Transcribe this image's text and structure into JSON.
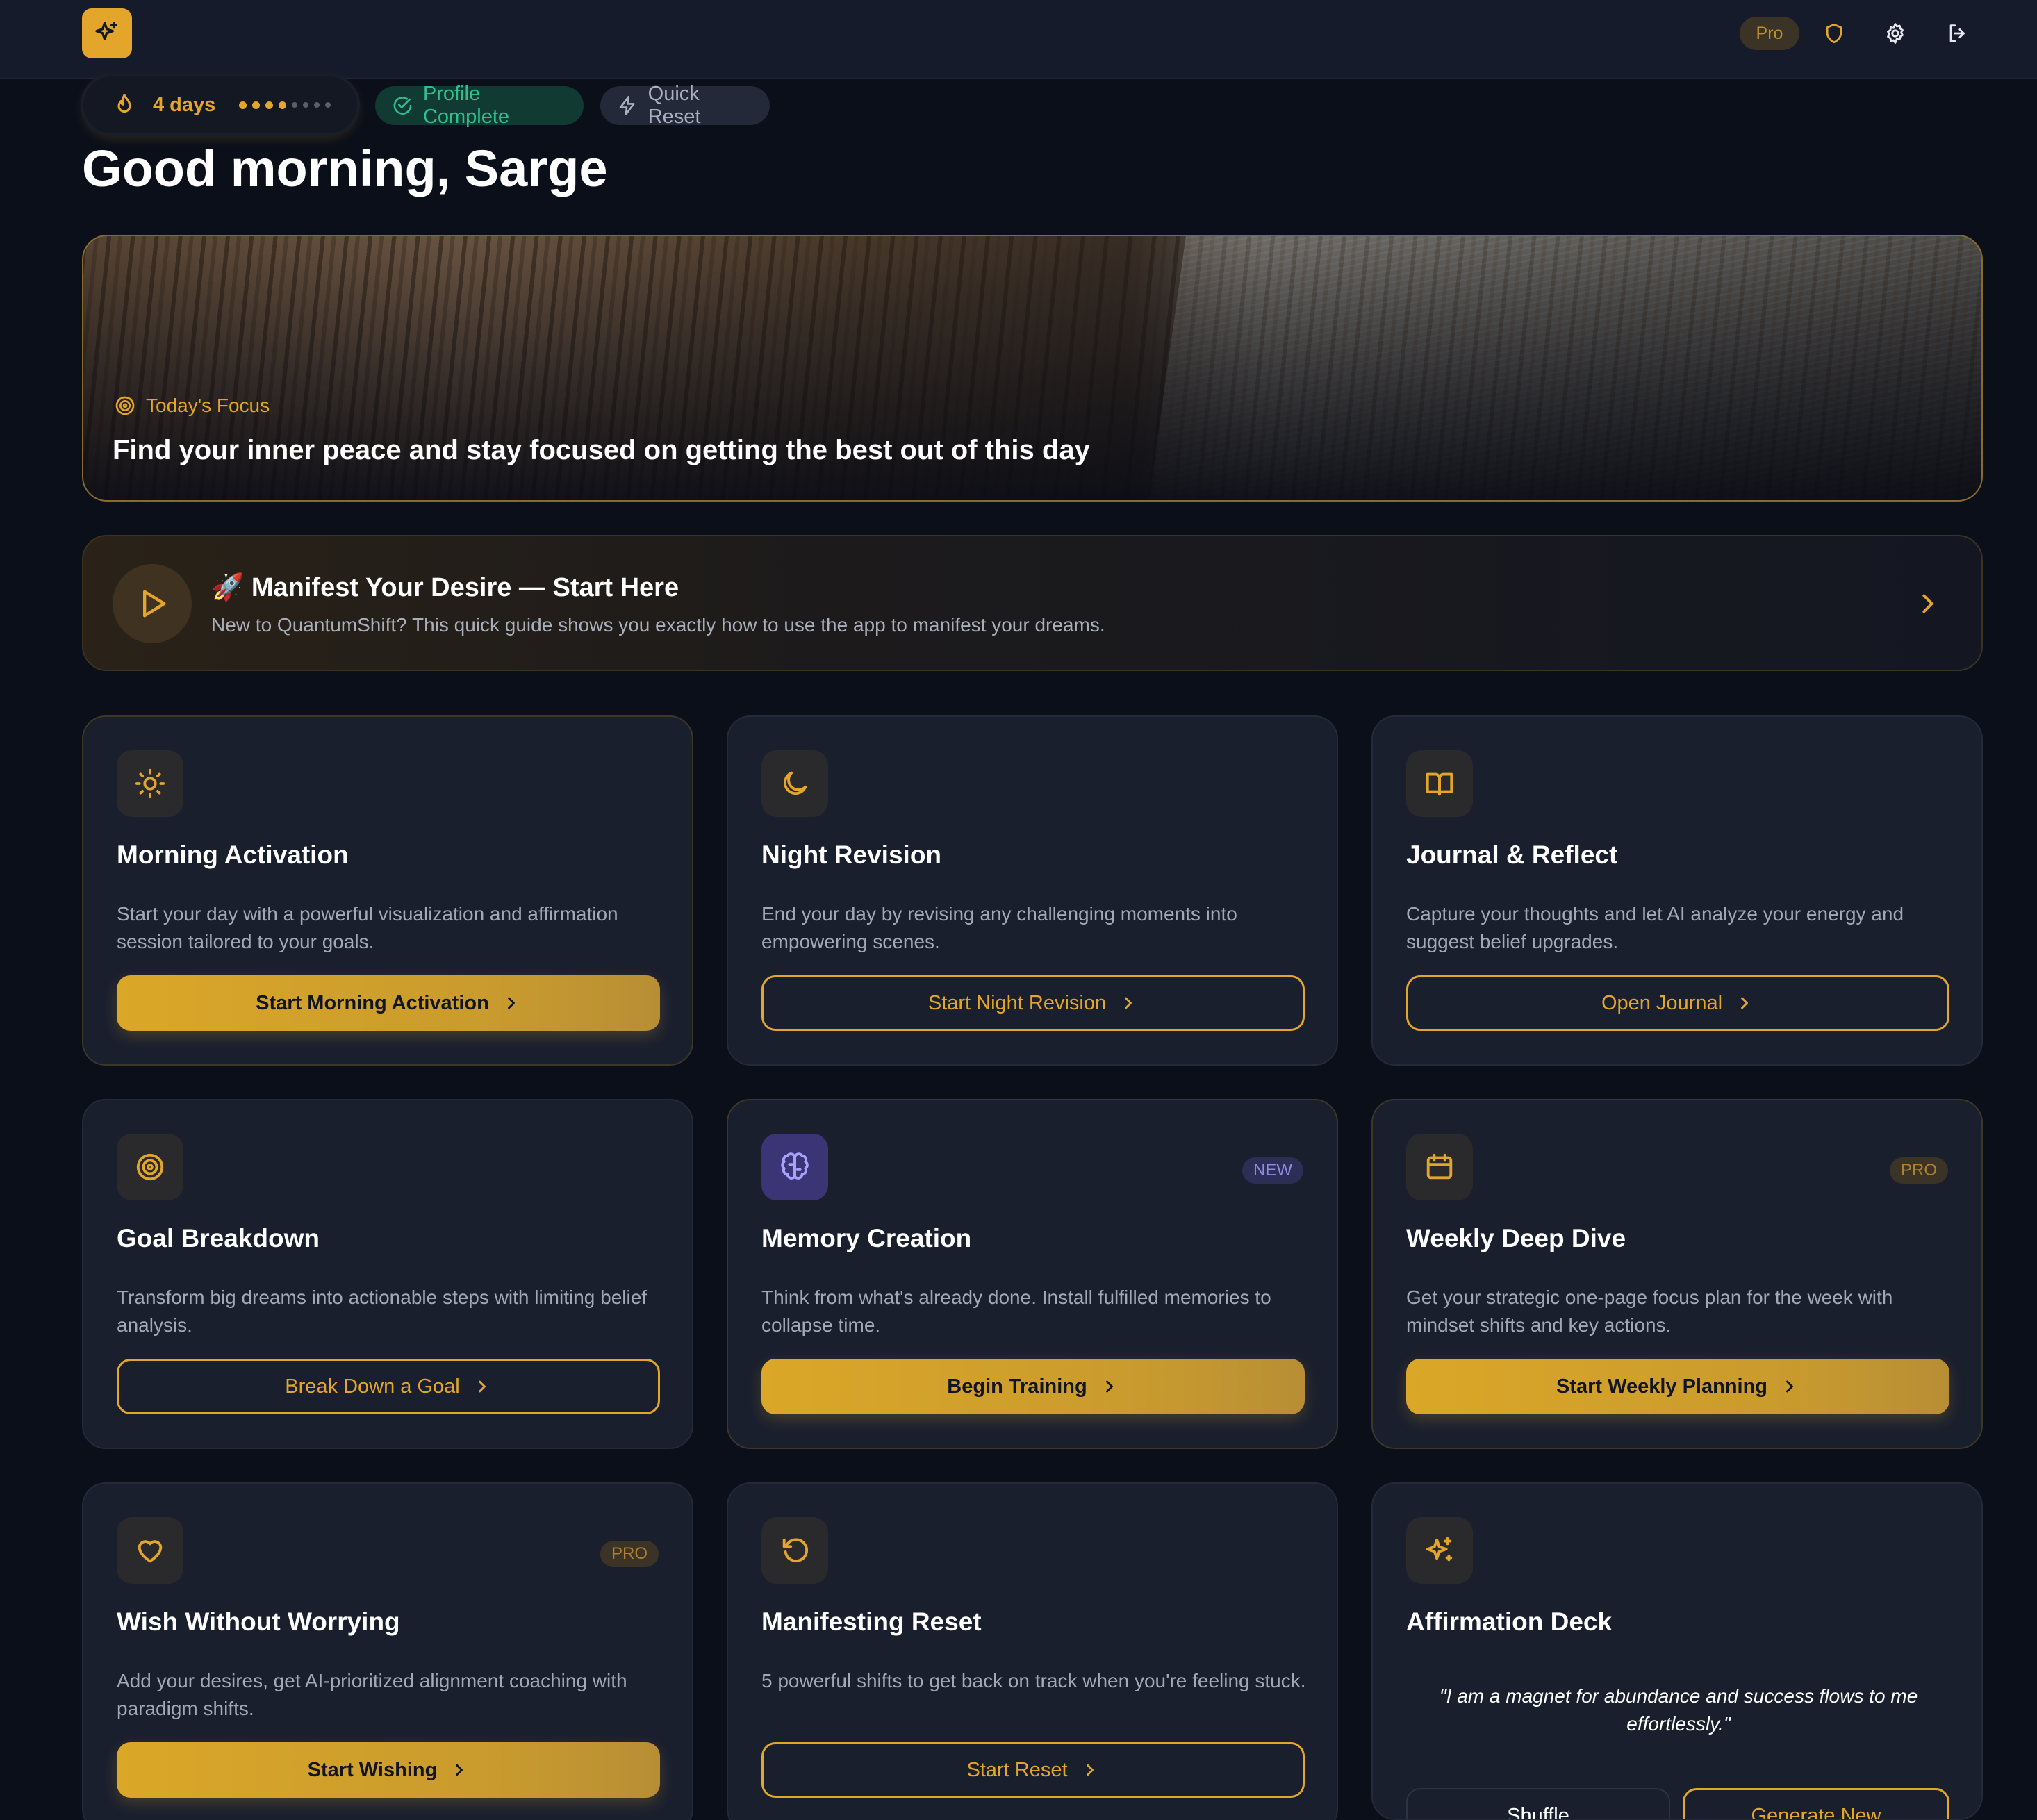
{
  "header": {
    "plan_badge": "Pro",
    "colors": {
      "accent": "#e3a62a",
      "background": "#0b0f1a",
      "surface": "#1a1f2e"
    }
  },
  "status": {
    "streak_label": "4 days",
    "streak_filled": 4,
    "streak_total": 8,
    "profile_chip": "Profile Complete",
    "quick_reset_chip": "Quick Reset"
  },
  "greeting": "Good morning, Sarge",
  "hero": {
    "label": "Today's Focus",
    "text": "Find your inner peace and stay focused on getting the best out of this day"
  },
  "guide": {
    "title": "🚀 Manifest Your Desire — Start Here",
    "subtitle": "New to QuantumShift? This quick guide shows you exactly how to use the app to manifest your dreams."
  },
  "cards": [
    {
      "icon": "sun-icon",
      "title": "Morning Activation",
      "desc": "Start your day with a powerful visualization and affirmation session tailored to your goals.",
      "button": "Start Morning Activation",
      "style": "solid"
    },
    {
      "icon": "moon-icon",
      "title": "Night Revision",
      "desc": "End your day by revising any challenging moments into empowering scenes.",
      "button": "Start Night Revision",
      "style": "outline"
    },
    {
      "icon": "book-icon",
      "title": "Journal & Reflect",
      "desc": "Capture your thoughts and let AI analyze your energy and suggest belief upgrades.",
      "button": "Open Journal",
      "style": "outline"
    },
    {
      "icon": "target-icon",
      "title": "Goal Breakdown",
      "desc": "Transform big dreams into actionable steps with limiting belief analysis.",
      "button": "Break Down a Goal",
      "style": "outline"
    },
    {
      "icon": "brain-icon",
      "title": "Memory Creation",
      "badge": "NEW",
      "desc": "Think from what's already done. Install fulfilled memories to collapse time.",
      "button": "Begin Training",
      "style": "solid"
    },
    {
      "icon": "calendar-icon",
      "title": "Weekly Deep Dive",
      "badge": "PRO",
      "desc": "Get your strategic one-page focus plan for the week with mindset shifts and key actions.",
      "button": "Start Weekly Planning",
      "style": "solid"
    },
    {
      "icon": "heart-icon",
      "title": "Wish Without Worrying",
      "badge": "PRO",
      "desc": "Add your desires, get AI-prioritized alignment coaching with paradigm shifts.",
      "button": "Start Wishing",
      "style": "solid"
    },
    {
      "icon": "rotate-ccw-icon",
      "title": "Manifesting Reset",
      "desc": "5 powerful shifts to get back on track when you're feeling stuck.",
      "button": "Start Reset",
      "style": "outline"
    },
    {
      "icon": "sparkles-icon",
      "title": "Affirmation Deck",
      "quote": "\"I am a magnet for abundance and success flows to me effortlessly.\"",
      "shuffle": "Shuffle",
      "generate": "Generate New"
    }
  ]
}
